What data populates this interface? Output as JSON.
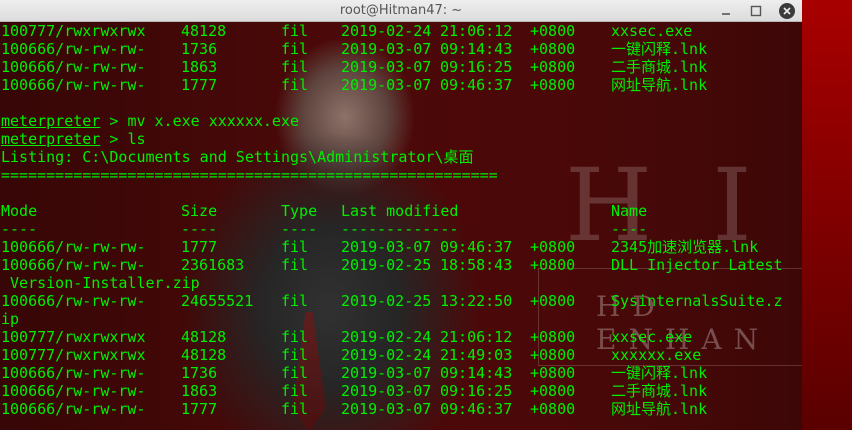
{
  "window": {
    "title": "root@Hitman47: ~"
  },
  "wallpaper": {
    "letters": "HIT",
    "subtitle": "HD ENHAN"
  },
  "terminal": {
    "top_rows": [
      {
        "mode": "100777/rwxrwxrwx",
        "size": "48128",
        "type": "fil",
        "date": "2019-02-24",
        "time": "21:06:12",
        "tz": "+0800",
        "name": "xxsec.exe"
      },
      {
        "mode": "100666/rw-rw-rw-",
        "size": "1736",
        "type": "fil",
        "date": "2019-03-07",
        "time": "09:14:43",
        "tz": "+0800",
        "name": "一键闪释.lnk"
      },
      {
        "mode": "100666/rw-rw-rw-",
        "size": "1863",
        "type": "fil",
        "date": "2019-03-07",
        "time": "09:16:25",
        "tz": "+0800",
        "name": "二手商城.lnk"
      },
      {
        "mode": "100666/rw-rw-rw-",
        "size": "1777",
        "type": "fil",
        "date": "2019-03-07",
        "time": "09:46:37",
        "tz": "+0800",
        "name": "网址导航.lnk"
      }
    ],
    "prompt_word": "meterpreter",
    "prompt_sep": " > ",
    "cmd1": "mv x.exe xxxxxx.exe",
    "cmd2": "ls",
    "listing_line": "Listing: C:\\Documents and Settings\\Administrator\\桌面",
    "separator": "=======================================================",
    "headers": {
      "mode": "Mode",
      "size": "Size",
      "type": "Type",
      "modified": "Last modified",
      "name": "Name"
    },
    "header_dashes": {
      "mode": "----",
      "size": "----",
      "type": "----",
      "modified": "-------------",
      "name": "----"
    },
    "rows": [
      {
        "mode": "100666/rw-rw-rw-",
        "size": "1777",
        "type": "fil",
        "date": "2019-03-07",
        "time": "09:46:37",
        "tz": "+0800",
        "name": "2345加速浏览器.lnk"
      },
      {
        "mode": "100666/rw-rw-rw-",
        "size": "2361683",
        "type": "fil",
        "date": "2019-02-25",
        "time": "18:58:43",
        "tz": "+0800",
        "name": "DLL Injector Latest",
        "wrap": " Version-Installer.zip"
      },
      {
        "mode": "100666/rw-rw-rw-",
        "size": "24655521",
        "type": "fil",
        "date": "2019-02-25",
        "time": "13:22:50",
        "tz": "+0800",
        "name": "SysinternalsSuite.z",
        "wrap": "ip"
      },
      {
        "mode": "100777/rwxrwxrwx",
        "size": "48128",
        "type": "fil",
        "date": "2019-02-24",
        "time": "21:06:12",
        "tz": "+0800",
        "name": "xxsec.exe"
      },
      {
        "mode": "100777/rwxrwxrwx",
        "size": "48128",
        "type": "fil",
        "date": "2019-02-24",
        "time": "21:49:03",
        "tz": "+0800",
        "name": "xxxxxx.exe"
      },
      {
        "mode": "100666/rw-rw-rw-",
        "size": "1736",
        "type": "fil",
        "date": "2019-03-07",
        "time": "09:14:43",
        "tz": "+0800",
        "name": "一键闪释.lnk"
      },
      {
        "mode": "100666/rw-rw-rw-",
        "size": "1863",
        "type": "fil",
        "date": "2019-03-07",
        "time": "09:16:25",
        "tz": "+0800",
        "name": "二手商城.lnk"
      },
      {
        "mode": "100666/rw-rw-rw-",
        "size": "1777",
        "type": "fil",
        "date": "2019-03-07",
        "time": "09:46:37",
        "tz": "+0800",
        "name": "网址导航.lnk"
      }
    ]
  },
  "colors": {
    "terminal_text": "#00ee00",
    "titlebar_bg": "#e6e6e6",
    "close_button": "#3b3b3b"
  }
}
